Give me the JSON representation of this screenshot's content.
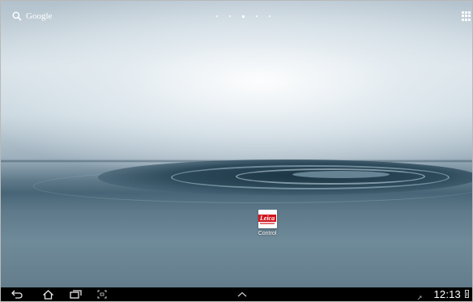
{
  "search": {
    "label": "Google",
    "icon": "search-icon"
  },
  "home_pages": {
    "count": 5,
    "active_index": 2
  },
  "apps_button": {
    "icon": "apps-grid-icon"
  },
  "desktop_apps": [
    {
      "label": "Control",
      "logo_text": "Leica",
      "brand_color": "#d2151d",
      "icon": "leica-app-icon"
    }
  ],
  "navbar": {
    "back_icon": "back-icon",
    "home_icon": "home-icon",
    "recents_icon": "recent-apps-icon",
    "screenshot_icon": "screenshot-icon",
    "up_icon": "chevron-up-icon",
    "sync_icon": "sync-icon",
    "clock": "12:13",
    "battery_icon": "battery-icon"
  }
}
